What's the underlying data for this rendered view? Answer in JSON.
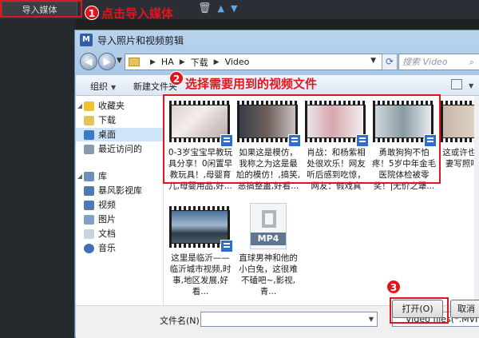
{
  "host": {
    "import_button": "导入媒体"
  },
  "annotations": {
    "step1_num": "1",
    "step1_text": "点击导入媒体",
    "step2_num": "2",
    "step2_text": "选择需要用到的视频文件",
    "step3_num": "3",
    "accent_color": "#e0161d"
  },
  "dialog": {
    "title": "导入照片和视频剪辑",
    "breadcrumb": [
      "HA",
      "下载",
      "Video"
    ],
    "search_placeholder": "搜索 Video",
    "toolbar": {
      "organize": "组织",
      "new_folder": "新建文件夹"
    },
    "nav": {
      "favorites": "收藏夹",
      "downloads": "下载",
      "desktop": "桌面",
      "recent": "最近访问的",
      "libraries": "库",
      "baofeng": "暴风影视库",
      "videos": "视频",
      "pictures": "图片",
      "documents": "文档",
      "music": "音乐"
    },
    "files": [
      {
        "name": "0-3岁宝宝早教玩具分享！0闲置早教玩具！,母婴育儿,母婴用品,好...",
        "icon": "video-thumbnail-icon"
      },
      {
        "name": "如果这是模仿，我称之为这是最尬的模仿！,搞笑,恶搞整蛊,好看...",
        "icon": "video-thumbnail-icon"
      },
      {
        "name": "肖战：和杨紫相处很欢乐！网友听后感到吃惊，网友：假戏真做...",
        "icon": "video-thumbnail-icon"
      },
      {
        "name": "勇敢狗狗不怕疼！5岁中年金毛医院体检被零奖！|无价之犟...",
        "icon": "video-thumbnail-icon"
      },
      {
        "name": "这或许也中年夫妻写照吧,好看",
        "icon": "video-thumbnail-icon"
      },
      {
        "name": "这里是临沂——临沂城市视频,时事,地区发展,好看...",
        "icon": "video-thumbnail-icon"
      },
      {
        "name": "直球男神和他的小白兔，这很难不磕吧~,影视,青...",
        "icon": "mp4-file-icon",
        "badge": "MP4"
      }
    ],
    "filename_label": "文件名(N):",
    "filename_value": "",
    "filetype_value": "Video files(*.MVI *.MOV",
    "open_button": "打开(O)",
    "cancel_button": "取消"
  }
}
